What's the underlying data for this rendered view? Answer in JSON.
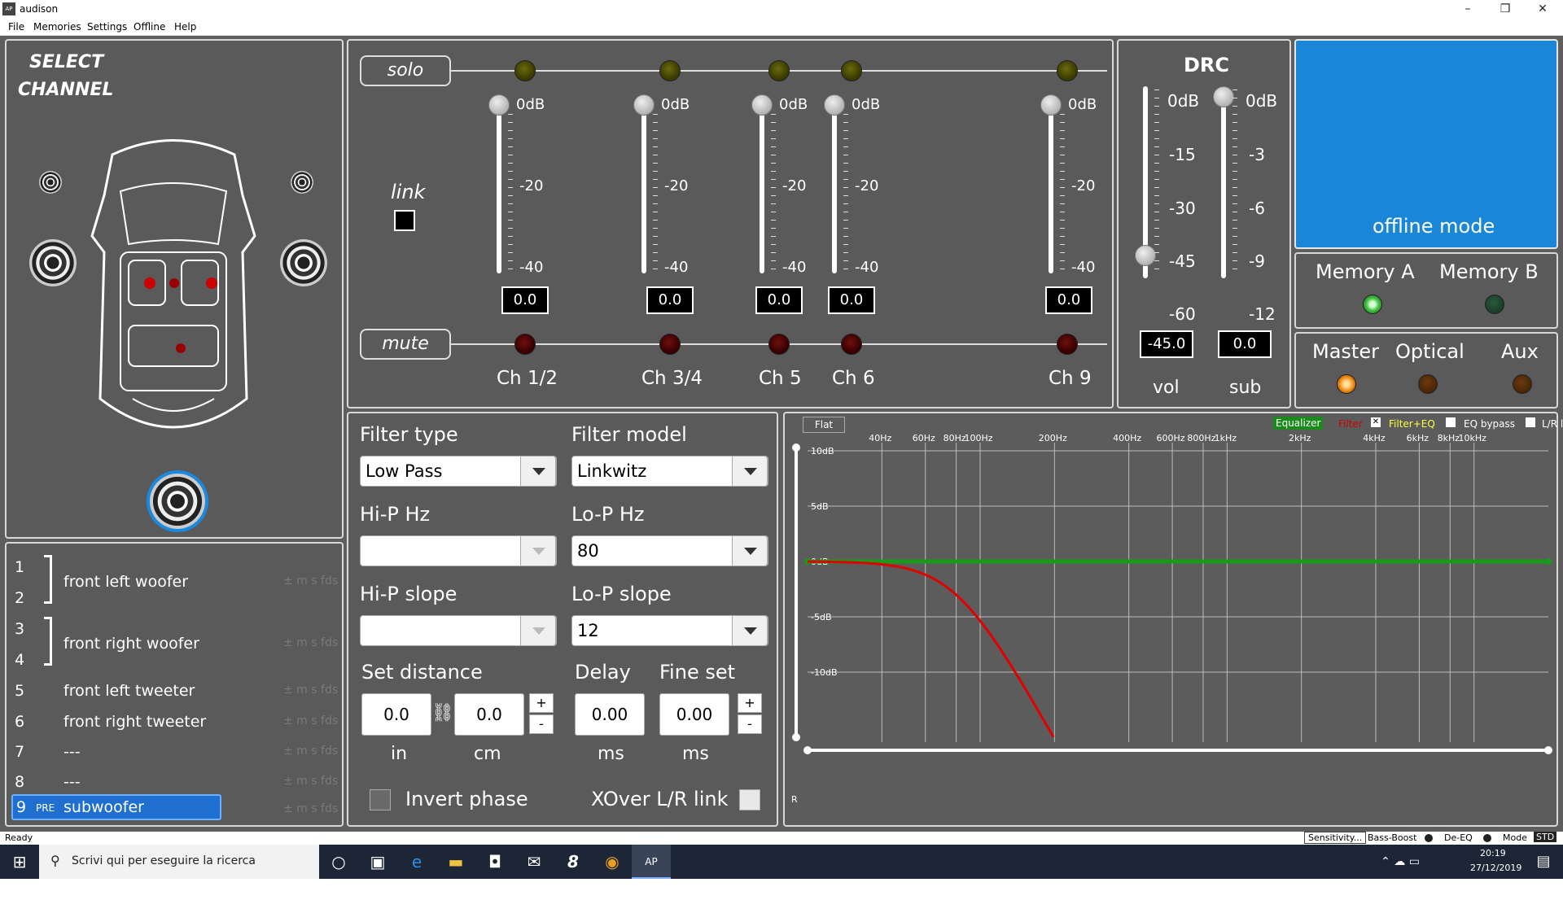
{
  "window": {
    "title": "audison",
    "min": "–",
    "max": "❐",
    "close": "✕"
  },
  "menu": [
    "File",
    "Memories",
    "Settings",
    "Offline",
    "Help"
  ],
  "select_channel": {
    "line1": "SELECT",
    "line2": "CHANNEL"
  },
  "mixer": {
    "solo": "solo",
    "mute": "mute",
    "link": "link",
    "scale": [
      "0dB",
      "-20",
      "-40"
    ],
    "channels": [
      {
        "label": "Ch 1/2",
        "value": "0.0"
      },
      {
        "label": "Ch 3/4",
        "value": "0.0"
      },
      {
        "label": "Ch 5",
        "value": "0.0"
      },
      {
        "label": "Ch 6",
        "value": "0.0"
      },
      {
        "label": "Ch 9",
        "value": "0.0"
      }
    ]
  },
  "drc": {
    "title": "DRC",
    "vol_scale": [
      "0dB",
      "-15",
      "-30",
      "-45",
      "-60"
    ],
    "sub_scale": [
      "0dB",
      "-3",
      "-6",
      "-9",
      "-12"
    ],
    "vol_value": "-45.0",
    "sub_value": "0.0",
    "vol_label": "vol",
    "sub_label": "sub",
    "vol_level_db": -45,
    "sub_level_db": 0
  },
  "offline": {
    "label": "offline mode"
  },
  "memory": {
    "a": "Memory A",
    "b": "Memory B"
  },
  "source": {
    "master": "Master",
    "optical": "Optical",
    "aux": "Aux"
  },
  "filter": {
    "type_label": "Filter type",
    "type_value": "Low Pass",
    "model_label": "Filter model",
    "model_value": "Linkwitz",
    "hip_hz_label": "Hi-P Hz",
    "hip_hz_value": "",
    "lop_hz_label": "Lo-P Hz",
    "lop_hz_value": "80",
    "hip_slope_label": "Hi-P slope",
    "hip_slope_value": "",
    "lop_slope_label": "Lo-P slope",
    "lop_slope_value": "12",
    "distance_label": "Set distance",
    "dist_in": "0.0",
    "dist_cm": "0.0",
    "unit_in": "in",
    "unit_cm": "cm",
    "delay_label": "Delay",
    "delay_value": "0.00",
    "delay_unit": "ms",
    "fine_label": "Fine set",
    "fine_value": "0.00",
    "fine_unit": "ms",
    "plus": "+",
    "minus": "-",
    "invert_phase": "Invert phase",
    "xover_link": "XOver L/R link"
  },
  "channel_list": [
    {
      "nums": [
        "1",
        "2"
      ],
      "name": "front left woofer",
      "info": "± m s fds"
    },
    {
      "nums": [
        "3",
        "4"
      ],
      "name": "front right woofer",
      "info": "± m s fds"
    },
    {
      "num": "5",
      "name": "front left tweeter",
      "info": "± m s fds"
    },
    {
      "num": "6",
      "name": "front right tweeter",
      "info": "± m s fds"
    },
    {
      "num": "7",
      "name": "---",
      "info": "± m s fds"
    },
    {
      "num": "8",
      "name": "---",
      "info": "± m s fds"
    },
    {
      "num": "9",
      "pre": "PRE",
      "name": "subwoofer",
      "info": "± m s fds",
      "selected": true
    }
  ],
  "graph": {
    "flat": "Flat",
    "equalizer": "Equalizer",
    "filter": "Filter",
    "filter_eq": "Filter+EQ",
    "eq_bypass": "EQ bypass",
    "lr_link": "L/R link",
    "freq_labels": [
      "40Hz",
      "60Hz",
      "80Hz",
      "100Hz",
      "200Hz",
      "400Hz",
      "600Hz",
      "800Hz",
      "1kHz",
      "2kHz",
      "4kHz",
      "6kHz",
      "8kHz",
      "10kHz"
    ],
    "db_labels": [
      "10dB",
      "5dB",
      "0dB",
      "-5dB",
      "-10dB"
    ],
    "r_label": "R"
  },
  "statusbar": {
    "ready": "Ready",
    "sensitivity": "Sensitivity...",
    "bass_boost": "Bass-Boost",
    "de_eq": "De-EQ",
    "mode": "Mode",
    "std": "STD"
  },
  "taskbar": {
    "search": "Scrivi qui per eseguire la ricerca",
    "time": "20:19",
    "date": "27/12/2019"
  }
}
